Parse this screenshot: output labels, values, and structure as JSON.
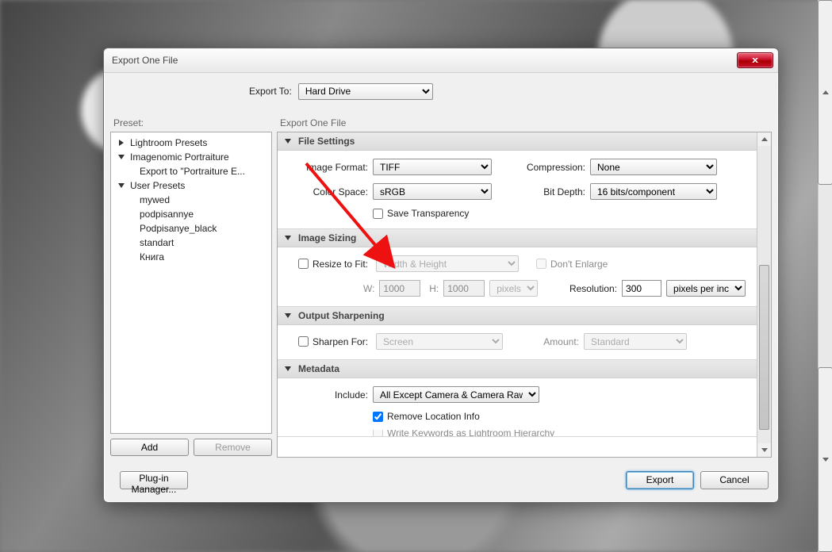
{
  "window": {
    "title": "Export One File"
  },
  "exportTo": {
    "label": "Export To:",
    "value": "Hard Drive"
  },
  "presets": {
    "header": "Preset:",
    "items": [
      {
        "label": "Lightroom Presets",
        "expanded": false,
        "children": []
      },
      {
        "label": "Imagenomic Portraiture",
        "expanded": true,
        "children": [
          {
            "label": "Export to \"Portraiture E..."
          }
        ]
      },
      {
        "label": "User Presets",
        "expanded": true,
        "children": [
          {
            "label": "mywed"
          },
          {
            "label": "podpisannye"
          },
          {
            "label": "Podpisanye_black"
          },
          {
            "label": "standart"
          },
          {
            "label": "Книга"
          }
        ]
      }
    ],
    "add": "Add",
    "remove": "Remove"
  },
  "rightHeader": "Export One File",
  "fileSettings": {
    "title": "File Settings",
    "imageFormatLabel": "Image Format:",
    "imageFormat": "TIFF",
    "compressionLabel": "Compression:",
    "compression": "None",
    "colorSpaceLabel": "Color Space:",
    "colorSpace": "sRGB",
    "bitDepthLabel": "Bit Depth:",
    "bitDepth": "16 bits/component",
    "saveTransparency": "Save Transparency"
  },
  "imageSizing": {
    "title": "Image Sizing",
    "resizeToFit": "Resize to Fit:",
    "mode": "Width & Height",
    "dontEnlarge": "Don't Enlarge",
    "wLabel": "W:",
    "w": "1000",
    "hLabel": "H:",
    "h": "1000",
    "unit": "pixels",
    "resolutionLabel": "Resolution:",
    "resolution": "300",
    "resolutionUnit": "pixels per inch"
  },
  "outputSharpening": {
    "title": "Output Sharpening",
    "sharpenFor": "Sharpen For:",
    "target": "Screen",
    "amountLabel": "Amount:",
    "amount": "Standard"
  },
  "metadata": {
    "title": "Metadata",
    "includeLabel": "Include:",
    "include": "All Except Camera & Camera Raw Info",
    "removeLocation": "Remove Location Info",
    "writeKeywords": "Write Keywords as Lightroom Hierarchy"
  },
  "footer": {
    "pluginManager": "Plug-in Manager...",
    "export": "Export",
    "cancel": "Cancel"
  }
}
